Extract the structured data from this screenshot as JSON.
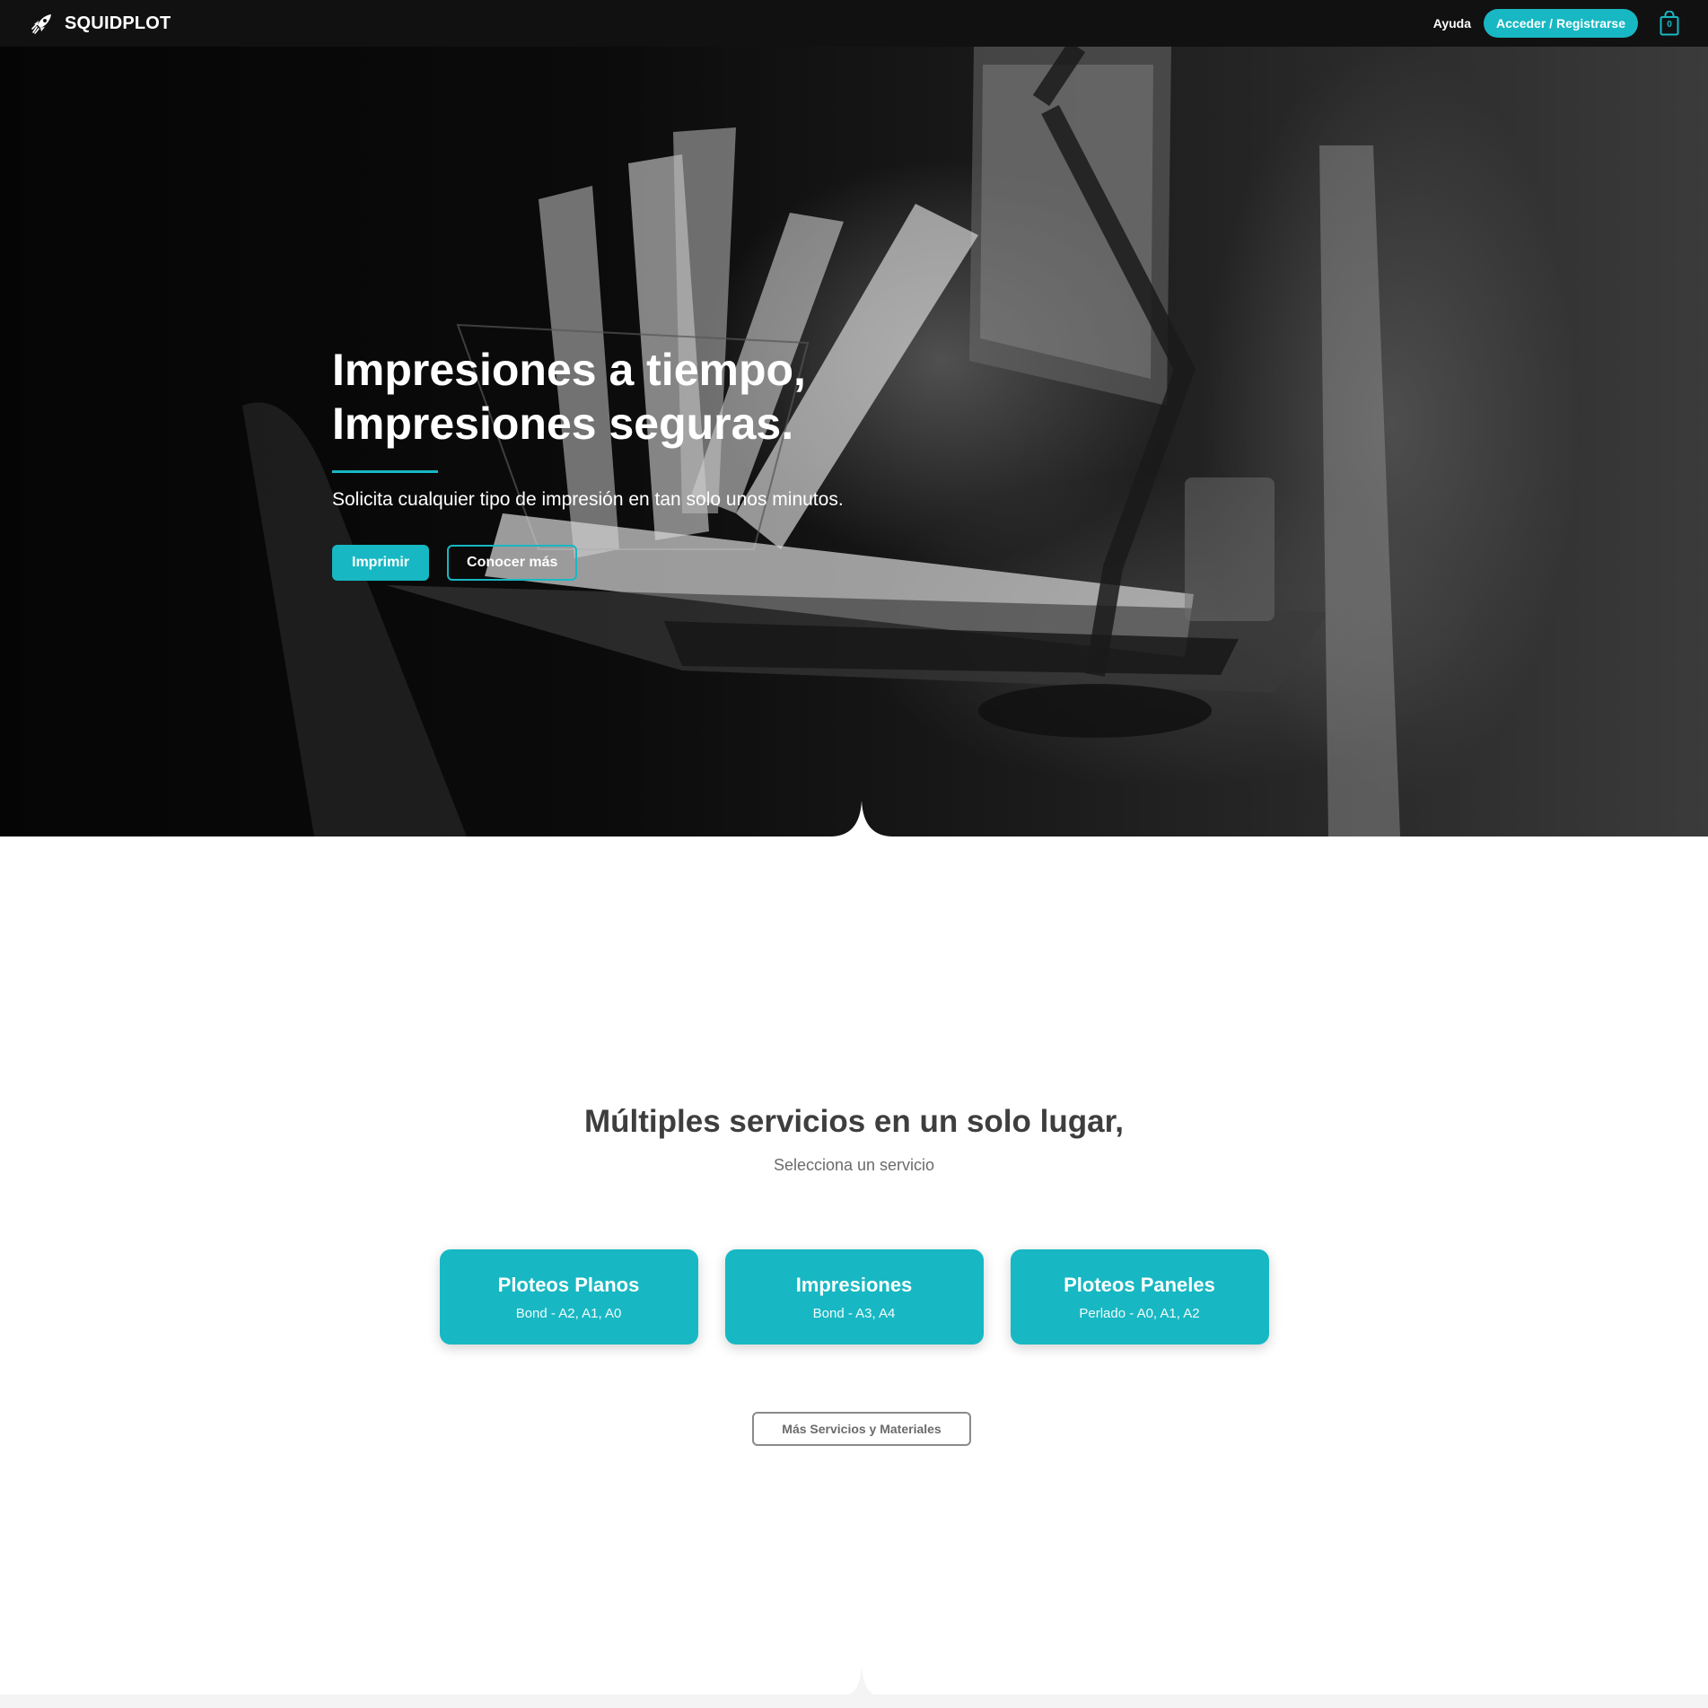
{
  "header": {
    "brand": "SQUIDPLOT",
    "help_link": "Ayuda",
    "login_button": "Acceder / Registrarse",
    "cart_count": "0"
  },
  "hero": {
    "title_line1": "Impresiones a tiempo,",
    "title_line2": "Impresiones seguras.",
    "subtitle": "Solicita cualquier tipo de impresión en tan solo unos minutos.",
    "primary_button": "Imprimir",
    "secondary_button": "Conocer más"
  },
  "services": {
    "title": "Múltiples servicios en un solo lugar,",
    "subtitle": "Selecciona un servicio",
    "cards": [
      {
        "title": "Ploteos Planos",
        "subtitle": "Bond - A2, A1, A0"
      },
      {
        "title": "Impresiones",
        "subtitle": "Bond - A3, A4"
      },
      {
        "title": "Ploteos Paneles",
        "subtitle": "Perlado - A0, A1, A2"
      }
    ],
    "more_button": "Más Servicios y Materiales"
  },
  "colors": {
    "accent": "#17b8c3",
    "header_bg": "#111111",
    "heading_text": "#3e3e3e"
  },
  "icons": {
    "brand": "rocket-icon",
    "cart": "shopping-bag-icon"
  }
}
